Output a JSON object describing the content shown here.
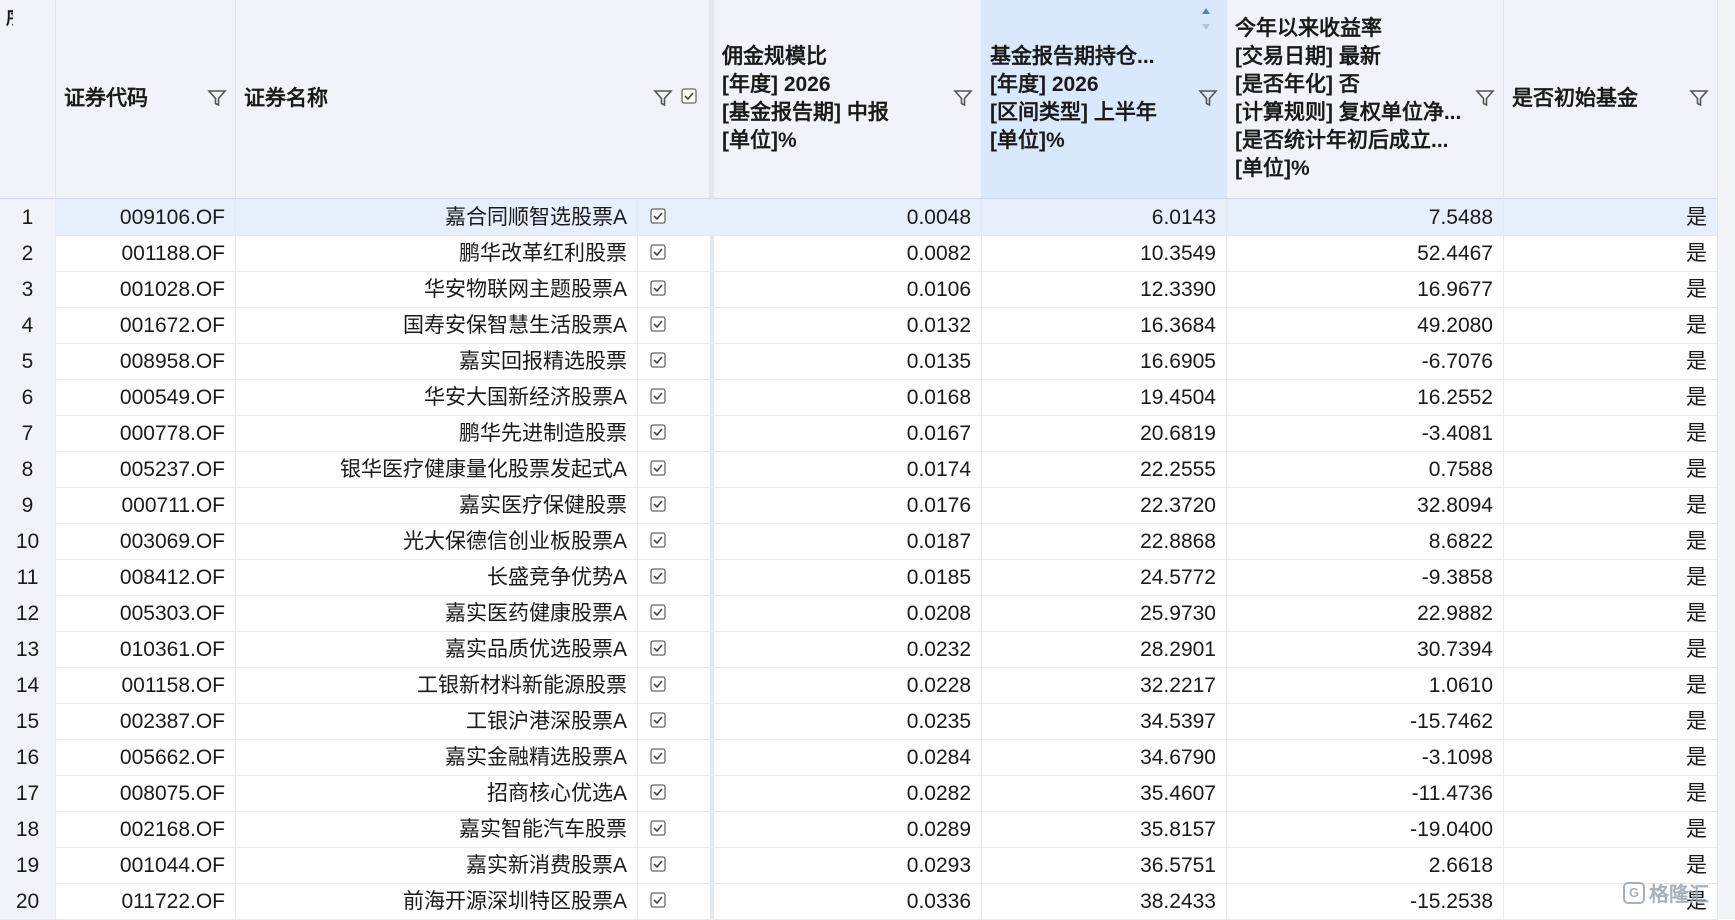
{
  "columns": {
    "index": [
      "序号"
    ],
    "code": [
      "证券代码"
    ],
    "name": [
      "证券名称"
    ],
    "commission": [
      "佣金规模比",
      "[年度]  2026",
      "[基金报告期]  中报",
      "[单位]%"
    ],
    "holding": [
      "基金报告期持仓...",
      "[年度]  2026",
      "[区间类型]  上半年",
      "[单位]%"
    ],
    "ytd_return": [
      "今年以来收益率",
      "[交易日期]  最新",
      "[是否年化]  否",
      "[计算规则]  复权单位净...",
      "[是否统计年初后成立...",
      "[单位]%"
    ],
    "initial_fund": [
      "是否初始基金"
    ]
  },
  "rows": [
    {
      "idx": "1",
      "code": "009106.OF",
      "name": "嘉合同顺智选股票A",
      "commission": "0.0048",
      "holding": "6.0143",
      "ytd": "7.5488",
      "initial": "是"
    },
    {
      "idx": "2",
      "code": "001188.OF",
      "name": "鹏华改革红利股票",
      "commission": "0.0082",
      "holding": "10.3549",
      "ytd": "52.4467",
      "initial": "是"
    },
    {
      "idx": "3",
      "code": "001028.OF",
      "name": "华安物联网主题股票A",
      "commission": "0.0106",
      "holding": "12.3390",
      "ytd": "16.9677",
      "initial": "是"
    },
    {
      "idx": "4",
      "code": "001672.OF",
      "name": "国寿安保智慧生活股票A",
      "commission": "0.0132",
      "holding": "16.3684",
      "ytd": "49.2080",
      "initial": "是"
    },
    {
      "idx": "5",
      "code": "008958.OF",
      "name": "嘉实回报精选股票",
      "commission": "0.0135",
      "holding": "16.6905",
      "ytd": "-6.7076",
      "initial": "是"
    },
    {
      "idx": "6",
      "code": "000549.OF",
      "name": "华安大国新经济股票A",
      "commission": "0.0168",
      "holding": "19.4504",
      "ytd": "16.2552",
      "initial": "是"
    },
    {
      "idx": "7",
      "code": "000778.OF",
      "name": "鹏华先进制造股票",
      "commission": "0.0167",
      "holding": "20.6819",
      "ytd": "-3.4081",
      "initial": "是"
    },
    {
      "idx": "8",
      "code": "005237.OF",
      "name": "银华医疗健康量化股票发起式A",
      "commission": "0.0174",
      "holding": "22.2555",
      "ytd": "0.7588",
      "initial": "是"
    },
    {
      "idx": "9",
      "code": "000711.OF",
      "name": "嘉实医疗保健股票",
      "commission": "0.0176",
      "holding": "22.3720",
      "ytd": "32.8094",
      "initial": "是"
    },
    {
      "idx": "10",
      "code": "003069.OF",
      "name": "光大保德信创业板股票A",
      "commission": "0.0187",
      "holding": "22.8868",
      "ytd": "8.6822",
      "initial": "是"
    },
    {
      "idx": "11",
      "code": "008412.OF",
      "name": "长盛竞争优势A",
      "commission": "0.0185",
      "holding": "24.5772",
      "ytd": "-9.3858",
      "initial": "是"
    },
    {
      "idx": "12",
      "code": "005303.OF",
      "name": "嘉实医药健康股票A",
      "commission": "0.0208",
      "holding": "25.9730",
      "ytd": "22.9882",
      "initial": "是"
    },
    {
      "idx": "13",
      "code": "010361.OF",
      "name": "嘉实品质优选股票A",
      "commission": "0.0232",
      "holding": "28.2901",
      "ytd": "30.7394",
      "initial": "是"
    },
    {
      "idx": "14",
      "code": "001158.OF",
      "name": "工银新材料新能源股票",
      "commission": "0.0228",
      "holding": "32.2217",
      "ytd": "1.0610",
      "initial": "是"
    },
    {
      "idx": "15",
      "code": "002387.OF",
      "name": "工银沪港深股票A",
      "commission": "0.0235",
      "holding": "34.5397",
      "ytd": "-15.7462",
      "initial": "是"
    },
    {
      "idx": "16",
      "code": "005662.OF",
      "name": "嘉实金融精选股票A",
      "commission": "0.0284",
      "holding": "34.6790",
      "ytd": "-3.1098",
      "initial": "是"
    },
    {
      "idx": "17",
      "code": "008075.OF",
      "name": "招商核心优选A",
      "commission": "0.0282",
      "holding": "35.4607",
      "ytd": "-11.4736",
      "initial": "是"
    },
    {
      "idx": "18",
      "code": "002168.OF",
      "name": "嘉实智能汽车股票",
      "commission": "0.0289",
      "holding": "35.8157",
      "ytd": "-19.0400",
      "initial": "是"
    },
    {
      "idx": "19",
      "code": "001044.OF",
      "name": "嘉实新消费股票A",
      "commission": "0.0293",
      "holding": "36.5751",
      "ytd": "2.6618",
      "initial": "是"
    },
    {
      "idx": "20",
      "code": "011722.OF",
      "name": "前海开源深圳特区股票A",
      "commission": "0.0336",
      "holding": "38.2433",
      "ytd": "-15.2538",
      "initial": "是"
    }
  ],
  "selected_row": 1,
  "sorted_column": "holding",
  "icons": {
    "filter": "filter-icon",
    "checkbox": "checkbox-icon",
    "sort": "sort-ascending-icon"
  },
  "watermark": "格隆汇",
  "colors": {
    "header_bg": "#f0f4fa",
    "sorted_header_bg": "#d9e8fb",
    "selected_row_bg": "#e6effb"
  }
}
